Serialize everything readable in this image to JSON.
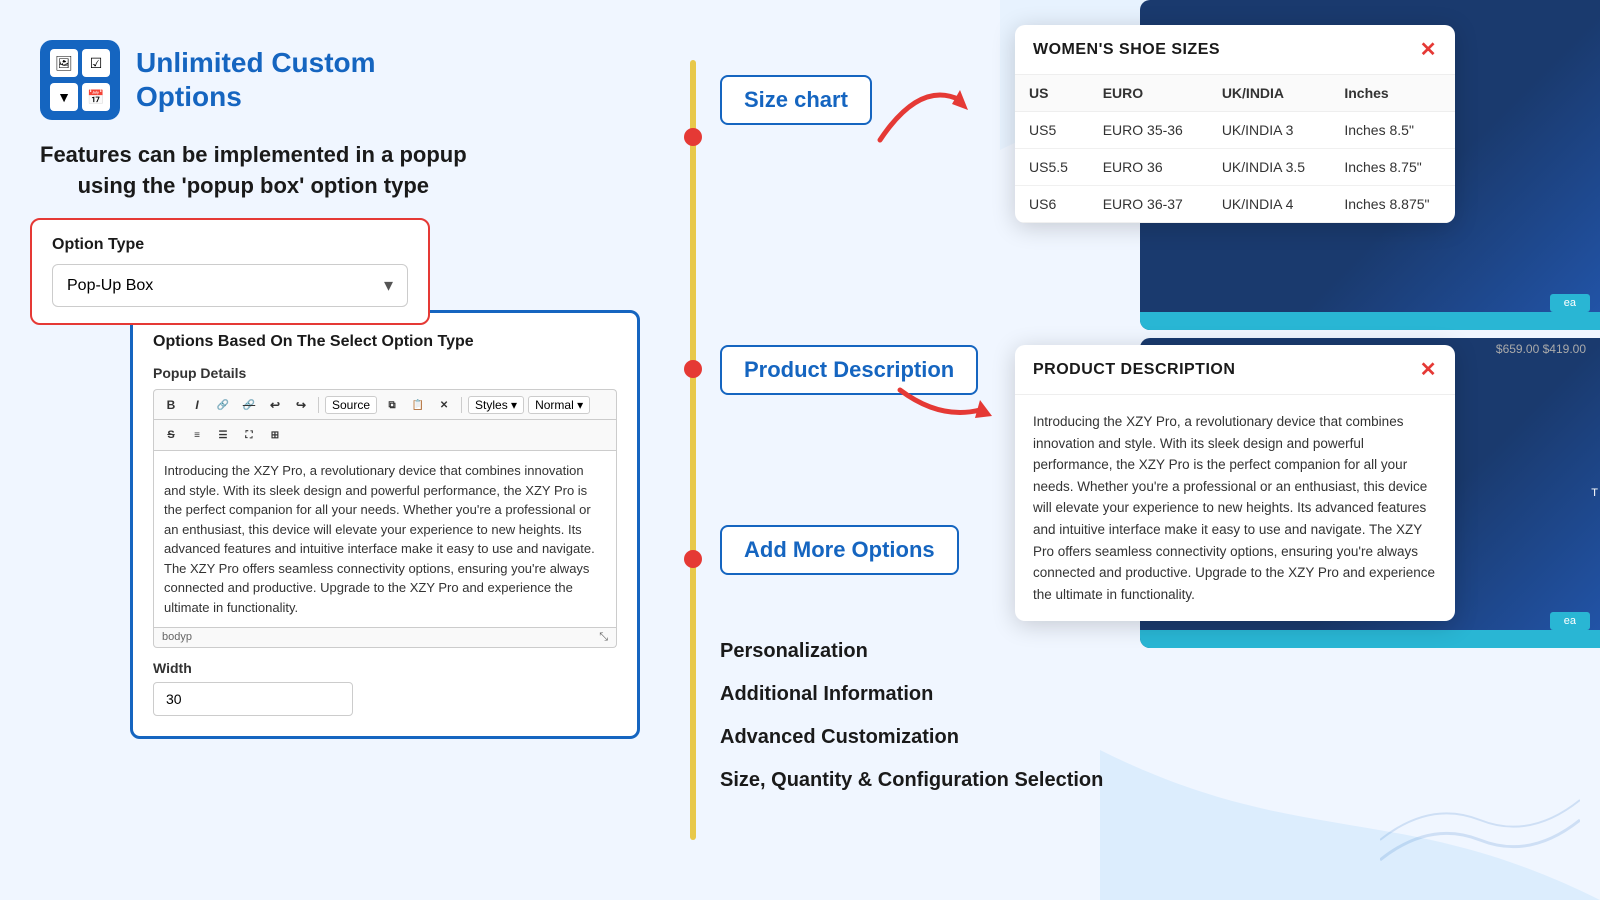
{
  "logo": {
    "title_line1": "Unlimited Custom",
    "title_line2": "Options"
  },
  "feature_text": "Features can be implemented in a popup\nusing the 'popup box' option type",
  "option_type": {
    "label": "Option Type",
    "selected": "Pop-Up Box"
  },
  "editor": {
    "title": "Options Based On The Select Option Type",
    "popup_details_label": "Popup Details",
    "toolbar": {
      "bold": "B",
      "italic": "I",
      "link": "🔗",
      "unlink": "🔗",
      "undo": "↩",
      "redo": "↪",
      "source": "Source",
      "copy": "⧉",
      "paste": "📋",
      "remove": "✕",
      "styles_label": "Styles",
      "normal_label": "Normal"
    },
    "content": "Introducing the XZY Pro, a revolutionary device that combines innovation and style. With its sleek design and powerful performance, the XZY Pro is the perfect companion for all your needs. Whether you're a professional or an enthusiast, this device will elevate your experience to new heights. Its advanced features and intuitive interface make it easy to use and navigate. The XZY Pro offers seamless connectivity options, ensuring you're always connected and productive. Upgrade to the XZY Pro and experience the ultimate in functionality.",
    "footer_tag1": "body",
    "footer_tag2": "p",
    "width_label": "Width",
    "width_value": "30"
  },
  "timeline_labels": {
    "size_chart": "Size chart",
    "product_description": "Product Description",
    "add_more_options": "Add More Options"
  },
  "size_chart_popup": {
    "title": "WOMEN'S SHOE SIZES",
    "headers": [
      "US",
      "EURO",
      "UK/INDIA",
      "Inches"
    ],
    "rows": [
      [
        "US5",
        "EURO 35-36",
        "UK/INDIA 3",
        "Inches 8.5\""
      ],
      [
        "US5.5",
        "EURO 36",
        "UK/INDIA 3.5",
        "Inches 8.75\""
      ],
      [
        "US6",
        "EURO 36-37",
        "UK/INDIA 4",
        "Inches 8.875\""
      ]
    ]
  },
  "product_desc_popup": {
    "title": "PRODUCT DESCRIPTION",
    "content": "Introducing the XZY Pro, a revolutionary device that combines innovation and style. With its sleek design and powerful performance, the XZY Pro is the perfect companion for all your needs. Whether you're a professional or an enthusiast, this device will elevate your experience to new heights. Its advanced features and intuitive interface make it easy to use and navigate. The XZY Pro offers seamless connectivity options, ensuring you're always connected and productive. Upgrade to the XZY Pro and experience the ultimate in functionality."
  },
  "feature_items": [
    "Personalization",
    "Additional Information",
    "Advanced Customization",
    "Size, Quantity & Configuration Selection"
  ],
  "colors": {
    "blue": "#1565c0",
    "red": "#e53935",
    "yellow": "#e8c84a",
    "bg": "#f0f6ff"
  }
}
